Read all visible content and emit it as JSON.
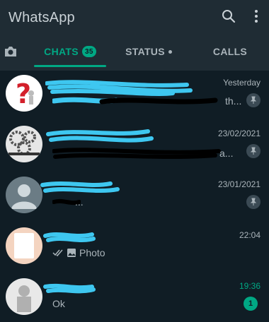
{
  "header": {
    "title": "WhatsApp",
    "icons": [
      "search-icon",
      "more-vert-icon"
    ]
  },
  "tabs": {
    "camera_icon": "camera-icon",
    "chats_label": "CHATS",
    "chats_badge": "35",
    "status_label": "STATUS",
    "calls_label": "CALLS"
  },
  "colors": {
    "accent": "#00a884",
    "background": "#101d25",
    "header": "#1f2c34"
  },
  "chats": [
    {
      "time": "Yesterday",
      "preview": "th...",
      "pinned": true
    },
    {
      "time": "23/02/2021",
      "preview": "a...",
      "pinned": true
    },
    {
      "time": "23/01/2021",
      "preview": "...",
      "pinned": true
    },
    {
      "time": "22:04",
      "preview": "Photo",
      "pinned": false
    },
    {
      "time": "19:36",
      "preview": "Ok",
      "unread": "1",
      "pinned": false
    }
  ]
}
